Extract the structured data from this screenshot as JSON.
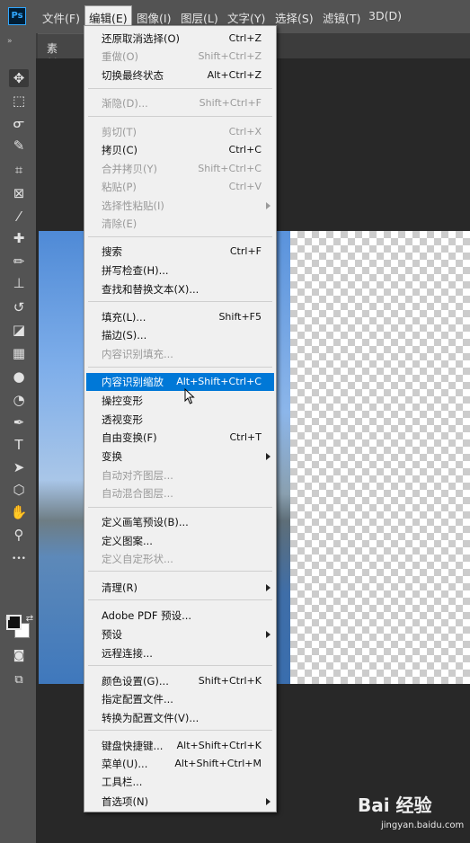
{
  "app": {
    "logo": "Ps"
  },
  "menubar": [
    {
      "label": "文件(F)"
    },
    {
      "label": "编辑(E)"
    },
    {
      "label": "图像(I)"
    },
    {
      "label": "图层(L)"
    },
    {
      "label": "文字(Y)"
    },
    {
      "label": "选择(S)"
    },
    {
      "label": "滤镜(T)"
    },
    {
      "label": "3D(D)"
    }
  ],
  "document_tab": {
    "label": "素材.jpg"
  },
  "toolbar": {
    "collapse_glyph": "»",
    "tools": [
      {
        "name": "move-tool-icon",
        "glyph": "✥"
      },
      {
        "name": "marquee-tool-icon",
        "glyph": "⬚"
      },
      {
        "name": "lasso-tool-icon",
        "glyph": "ᓂ"
      },
      {
        "name": "quick-select-tool-icon",
        "glyph": "✎"
      },
      {
        "name": "crop-tool-icon",
        "glyph": "⌗"
      },
      {
        "name": "frame-tool-icon",
        "glyph": "⊠"
      },
      {
        "name": "eyedropper-tool-icon",
        "glyph": "⁄"
      },
      {
        "name": "healing-brush-tool-icon",
        "glyph": "✚"
      },
      {
        "name": "brush-tool-icon",
        "glyph": "✏"
      },
      {
        "name": "clone-stamp-tool-icon",
        "glyph": "⊥"
      },
      {
        "name": "history-brush-tool-icon",
        "glyph": "↺"
      },
      {
        "name": "eraser-tool-icon",
        "glyph": "◪"
      },
      {
        "name": "gradient-tool-icon",
        "glyph": "▦"
      },
      {
        "name": "blur-tool-icon",
        "glyph": "●"
      },
      {
        "name": "dodge-tool-icon",
        "glyph": "◔"
      },
      {
        "name": "pen-tool-icon",
        "glyph": "✒"
      },
      {
        "name": "type-tool-icon",
        "glyph": "T"
      },
      {
        "name": "path-select-tool-icon",
        "glyph": "➤"
      },
      {
        "name": "shape-tool-icon",
        "glyph": "⬡"
      },
      {
        "name": "hand-tool-icon",
        "glyph": "✋"
      },
      {
        "name": "zoom-tool-icon",
        "glyph": "⚲"
      },
      {
        "name": "more-tools-icon",
        "glyph": "•••"
      }
    ]
  },
  "edit_menu": {
    "groups": [
      [
        {
          "label": "还原取消选择(O)",
          "shortcut": "Ctrl+Z",
          "disabled": false
        },
        {
          "label": "重做(O)",
          "shortcut": "Shift+Ctrl+Z",
          "disabled": true
        },
        {
          "label": "切换最终状态",
          "shortcut": "Alt+Ctrl+Z",
          "disabled": false
        }
      ],
      [
        {
          "label": "渐隐(D)...",
          "shortcut": "Shift+Ctrl+F",
          "disabled": true
        }
      ],
      [
        {
          "label": "剪切(T)",
          "shortcut": "Ctrl+X",
          "disabled": true
        },
        {
          "label": "拷贝(C)",
          "shortcut": "Ctrl+C",
          "disabled": false
        },
        {
          "label": "合并拷贝(Y)",
          "shortcut": "Shift+Ctrl+C",
          "disabled": true
        },
        {
          "label": "粘贴(P)",
          "shortcut": "Ctrl+V",
          "disabled": true
        },
        {
          "label": "选择性粘贴(I)",
          "shortcut": "",
          "disabled": true,
          "submenu": true
        },
        {
          "label": "清除(E)",
          "shortcut": "",
          "disabled": true
        }
      ],
      [
        {
          "label": "搜索",
          "shortcut": "Ctrl+F",
          "disabled": false
        },
        {
          "label": "拼写检查(H)...",
          "shortcut": "",
          "disabled": false
        },
        {
          "label": "查找和替换文本(X)...",
          "shortcut": "",
          "disabled": false
        }
      ],
      [
        {
          "label": "填充(L)...",
          "shortcut": "Shift+F5",
          "disabled": false
        },
        {
          "label": "描边(S)...",
          "shortcut": "",
          "disabled": false
        },
        {
          "label": "内容识别填充...",
          "shortcut": "",
          "disabled": true
        }
      ],
      [
        {
          "label": "内容识别缩放",
          "shortcut": "Alt+Shift+Ctrl+C",
          "disabled": false,
          "highlight": true
        },
        {
          "label": "操控变形",
          "shortcut": "",
          "disabled": false
        },
        {
          "label": "透视变形",
          "shortcut": "",
          "disabled": false
        },
        {
          "label": "自由变换(F)",
          "shortcut": "Ctrl+T",
          "disabled": false
        },
        {
          "label": "变换",
          "shortcut": "",
          "disabled": false,
          "submenu": true
        },
        {
          "label": "自动对齐图层...",
          "shortcut": "",
          "disabled": true
        },
        {
          "label": "自动混合图层...",
          "shortcut": "",
          "disabled": true
        }
      ],
      [
        {
          "label": "定义画笔预设(B)...",
          "shortcut": "",
          "disabled": false
        },
        {
          "label": "定义图案...",
          "shortcut": "",
          "disabled": false
        },
        {
          "label": "定义自定形状...",
          "shortcut": "",
          "disabled": true
        }
      ],
      [
        {
          "label": "清理(R)",
          "shortcut": "",
          "disabled": false,
          "submenu": true
        }
      ],
      [
        {
          "label": "Adobe PDF 预设...",
          "shortcut": "",
          "disabled": false
        },
        {
          "label": "预设",
          "shortcut": "",
          "disabled": false,
          "submenu": true
        },
        {
          "label": "远程连接...",
          "shortcut": "",
          "disabled": false
        }
      ],
      [
        {
          "label": "颜色设置(G)...",
          "shortcut": "Shift+Ctrl+K",
          "disabled": false
        },
        {
          "label": "指定配置文件...",
          "shortcut": "",
          "disabled": false
        },
        {
          "label": "转换为配置文件(V)...",
          "shortcut": "",
          "disabled": false
        }
      ],
      [
        {
          "label": "键盘快捷键...",
          "shortcut": "Alt+Shift+Ctrl+K",
          "disabled": false
        },
        {
          "label": "菜单(U)...",
          "shortcut": "Alt+Shift+Ctrl+M",
          "disabled": false
        },
        {
          "label": "工具栏...",
          "shortcut": "",
          "disabled": false
        },
        {
          "label": "首选项(N)",
          "shortcut": "",
          "disabled": false,
          "submenu": true
        }
      ]
    ]
  },
  "watermark": {
    "logo": "Bai 经验",
    "url": "jingyan.baidu.com"
  }
}
